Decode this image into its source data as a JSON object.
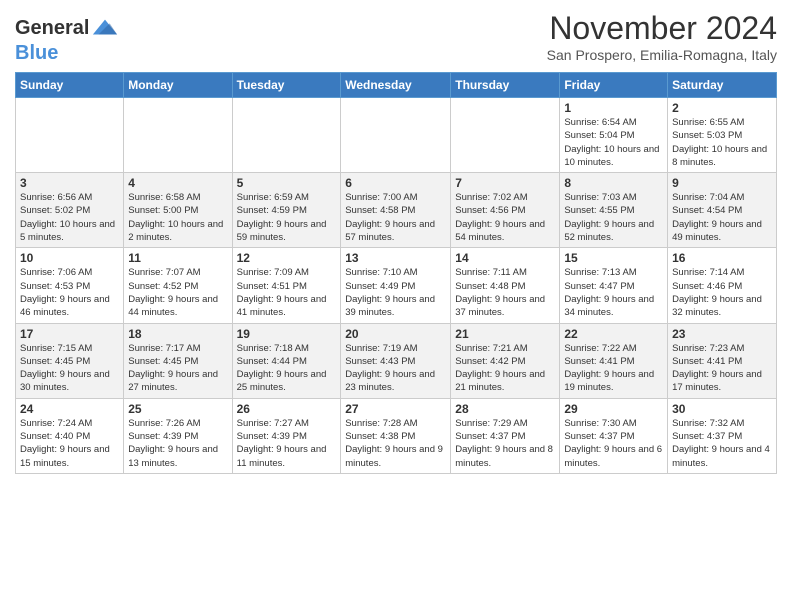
{
  "header": {
    "logo_line1": "General",
    "logo_line2": "Blue",
    "month": "November 2024",
    "location": "San Prospero, Emilia-Romagna, Italy"
  },
  "days_of_week": [
    "Sunday",
    "Monday",
    "Tuesday",
    "Wednesday",
    "Thursday",
    "Friday",
    "Saturday"
  ],
  "weeks": [
    [
      {
        "day": "",
        "info": ""
      },
      {
        "day": "",
        "info": ""
      },
      {
        "day": "",
        "info": ""
      },
      {
        "day": "",
        "info": ""
      },
      {
        "day": "",
        "info": ""
      },
      {
        "day": "1",
        "info": "Sunrise: 6:54 AM\nSunset: 5:04 PM\nDaylight: 10 hours and 10 minutes."
      },
      {
        "day": "2",
        "info": "Sunrise: 6:55 AM\nSunset: 5:03 PM\nDaylight: 10 hours and 8 minutes."
      }
    ],
    [
      {
        "day": "3",
        "info": "Sunrise: 6:56 AM\nSunset: 5:02 PM\nDaylight: 10 hours and 5 minutes."
      },
      {
        "day": "4",
        "info": "Sunrise: 6:58 AM\nSunset: 5:00 PM\nDaylight: 10 hours and 2 minutes."
      },
      {
        "day": "5",
        "info": "Sunrise: 6:59 AM\nSunset: 4:59 PM\nDaylight: 9 hours and 59 minutes."
      },
      {
        "day": "6",
        "info": "Sunrise: 7:00 AM\nSunset: 4:58 PM\nDaylight: 9 hours and 57 minutes."
      },
      {
        "day": "7",
        "info": "Sunrise: 7:02 AM\nSunset: 4:56 PM\nDaylight: 9 hours and 54 minutes."
      },
      {
        "day": "8",
        "info": "Sunrise: 7:03 AM\nSunset: 4:55 PM\nDaylight: 9 hours and 52 minutes."
      },
      {
        "day": "9",
        "info": "Sunrise: 7:04 AM\nSunset: 4:54 PM\nDaylight: 9 hours and 49 minutes."
      }
    ],
    [
      {
        "day": "10",
        "info": "Sunrise: 7:06 AM\nSunset: 4:53 PM\nDaylight: 9 hours and 46 minutes."
      },
      {
        "day": "11",
        "info": "Sunrise: 7:07 AM\nSunset: 4:52 PM\nDaylight: 9 hours and 44 minutes."
      },
      {
        "day": "12",
        "info": "Sunrise: 7:09 AM\nSunset: 4:51 PM\nDaylight: 9 hours and 41 minutes."
      },
      {
        "day": "13",
        "info": "Sunrise: 7:10 AM\nSunset: 4:49 PM\nDaylight: 9 hours and 39 minutes."
      },
      {
        "day": "14",
        "info": "Sunrise: 7:11 AM\nSunset: 4:48 PM\nDaylight: 9 hours and 37 minutes."
      },
      {
        "day": "15",
        "info": "Sunrise: 7:13 AM\nSunset: 4:47 PM\nDaylight: 9 hours and 34 minutes."
      },
      {
        "day": "16",
        "info": "Sunrise: 7:14 AM\nSunset: 4:46 PM\nDaylight: 9 hours and 32 minutes."
      }
    ],
    [
      {
        "day": "17",
        "info": "Sunrise: 7:15 AM\nSunset: 4:45 PM\nDaylight: 9 hours and 30 minutes."
      },
      {
        "day": "18",
        "info": "Sunrise: 7:17 AM\nSunset: 4:45 PM\nDaylight: 9 hours and 27 minutes."
      },
      {
        "day": "19",
        "info": "Sunrise: 7:18 AM\nSunset: 4:44 PM\nDaylight: 9 hours and 25 minutes."
      },
      {
        "day": "20",
        "info": "Sunrise: 7:19 AM\nSunset: 4:43 PM\nDaylight: 9 hours and 23 minutes."
      },
      {
        "day": "21",
        "info": "Sunrise: 7:21 AM\nSunset: 4:42 PM\nDaylight: 9 hours and 21 minutes."
      },
      {
        "day": "22",
        "info": "Sunrise: 7:22 AM\nSunset: 4:41 PM\nDaylight: 9 hours and 19 minutes."
      },
      {
        "day": "23",
        "info": "Sunrise: 7:23 AM\nSunset: 4:41 PM\nDaylight: 9 hours and 17 minutes."
      }
    ],
    [
      {
        "day": "24",
        "info": "Sunrise: 7:24 AM\nSunset: 4:40 PM\nDaylight: 9 hours and 15 minutes."
      },
      {
        "day": "25",
        "info": "Sunrise: 7:26 AM\nSunset: 4:39 PM\nDaylight: 9 hours and 13 minutes."
      },
      {
        "day": "26",
        "info": "Sunrise: 7:27 AM\nSunset: 4:39 PM\nDaylight: 9 hours and 11 minutes."
      },
      {
        "day": "27",
        "info": "Sunrise: 7:28 AM\nSunset: 4:38 PM\nDaylight: 9 hours and 9 minutes."
      },
      {
        "day": "28",
        "info": "Sunrise: 7:29 AM\nSunset: 4:37 PM\nDaylight: 9 hours and 8 minutes."
      },
      {
        "day": "29",
        "info": "Sunrise: 7:30 AM\nSunset: 4:37 PM\nDaylight: 9 hours and 6 minutes."
      },
      {
        "day": "30",
        "info": "Sunrise: 7:32 AM\nSunset: 4:37 PM\nDaylight: 9 hours and 4 minutes."
      }
    ]
  ]
}
